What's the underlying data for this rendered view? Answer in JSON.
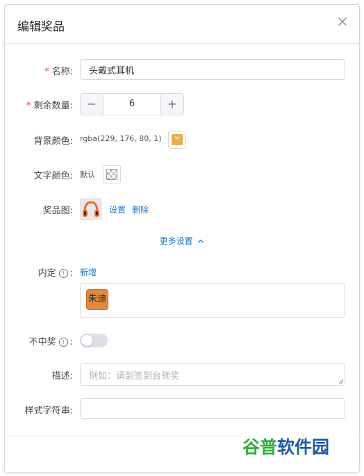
{
  "dialog": {
    "title": "编辑奖品",
    "close_icon": "close-icon"
  },
  "form": {
    "name": {
      "label": "名称:",
      "required": true,
      "value": "头戴式耳机"
    },
    "quantity": {
      "label": "剩余数量:",
      "required": true,
      "value": "6",
      "minus": "−",
      "plus": "+"
    },
    "bg_color": {
      "label": "背景颜色:",
      "value": "rgba(229, 176, 80, 1)",
      "swatch": "#e5b050"
    },
    "text_color": {
      "label": "文字颜色:",
      "value": "默认"
    },
    "prize_image": {
      "label": "奖品图:",
      "icon": "headphones-icon",
      "set_link": "设置",
      "delete_link": "删除"
    },
    "more_settings": {
      "label": "更多设置",
      "icon": "chevron-up-icon"
    },
    "internal": {
      "label": "内定",
      "suffix": ":",
      "add_link": "新增",
      "tags": [
        "朱迪"
      ]
    },
    "no_win": {
      "label": "不中奖",
      "suffix": ":",
      "enabled": false
    },
    "description": {
      "label": "描述:",
      "placeholder": "例如：请到签到台领奖"
    },
    "style_string": {
      "label": "样式字符串:",
      "value": ""
    }
  },
  "watermark": {
    "part1": "谷普",
    "part2": "软件园"
  },
  "colors": {
    "accent": "#1677d2",
    "required": "#e0403a",
    "tag": "#e5893a",
    "watermark_green": "#2fae3b",
    "watermark_blue": "#1e5aa8"
  }
}
